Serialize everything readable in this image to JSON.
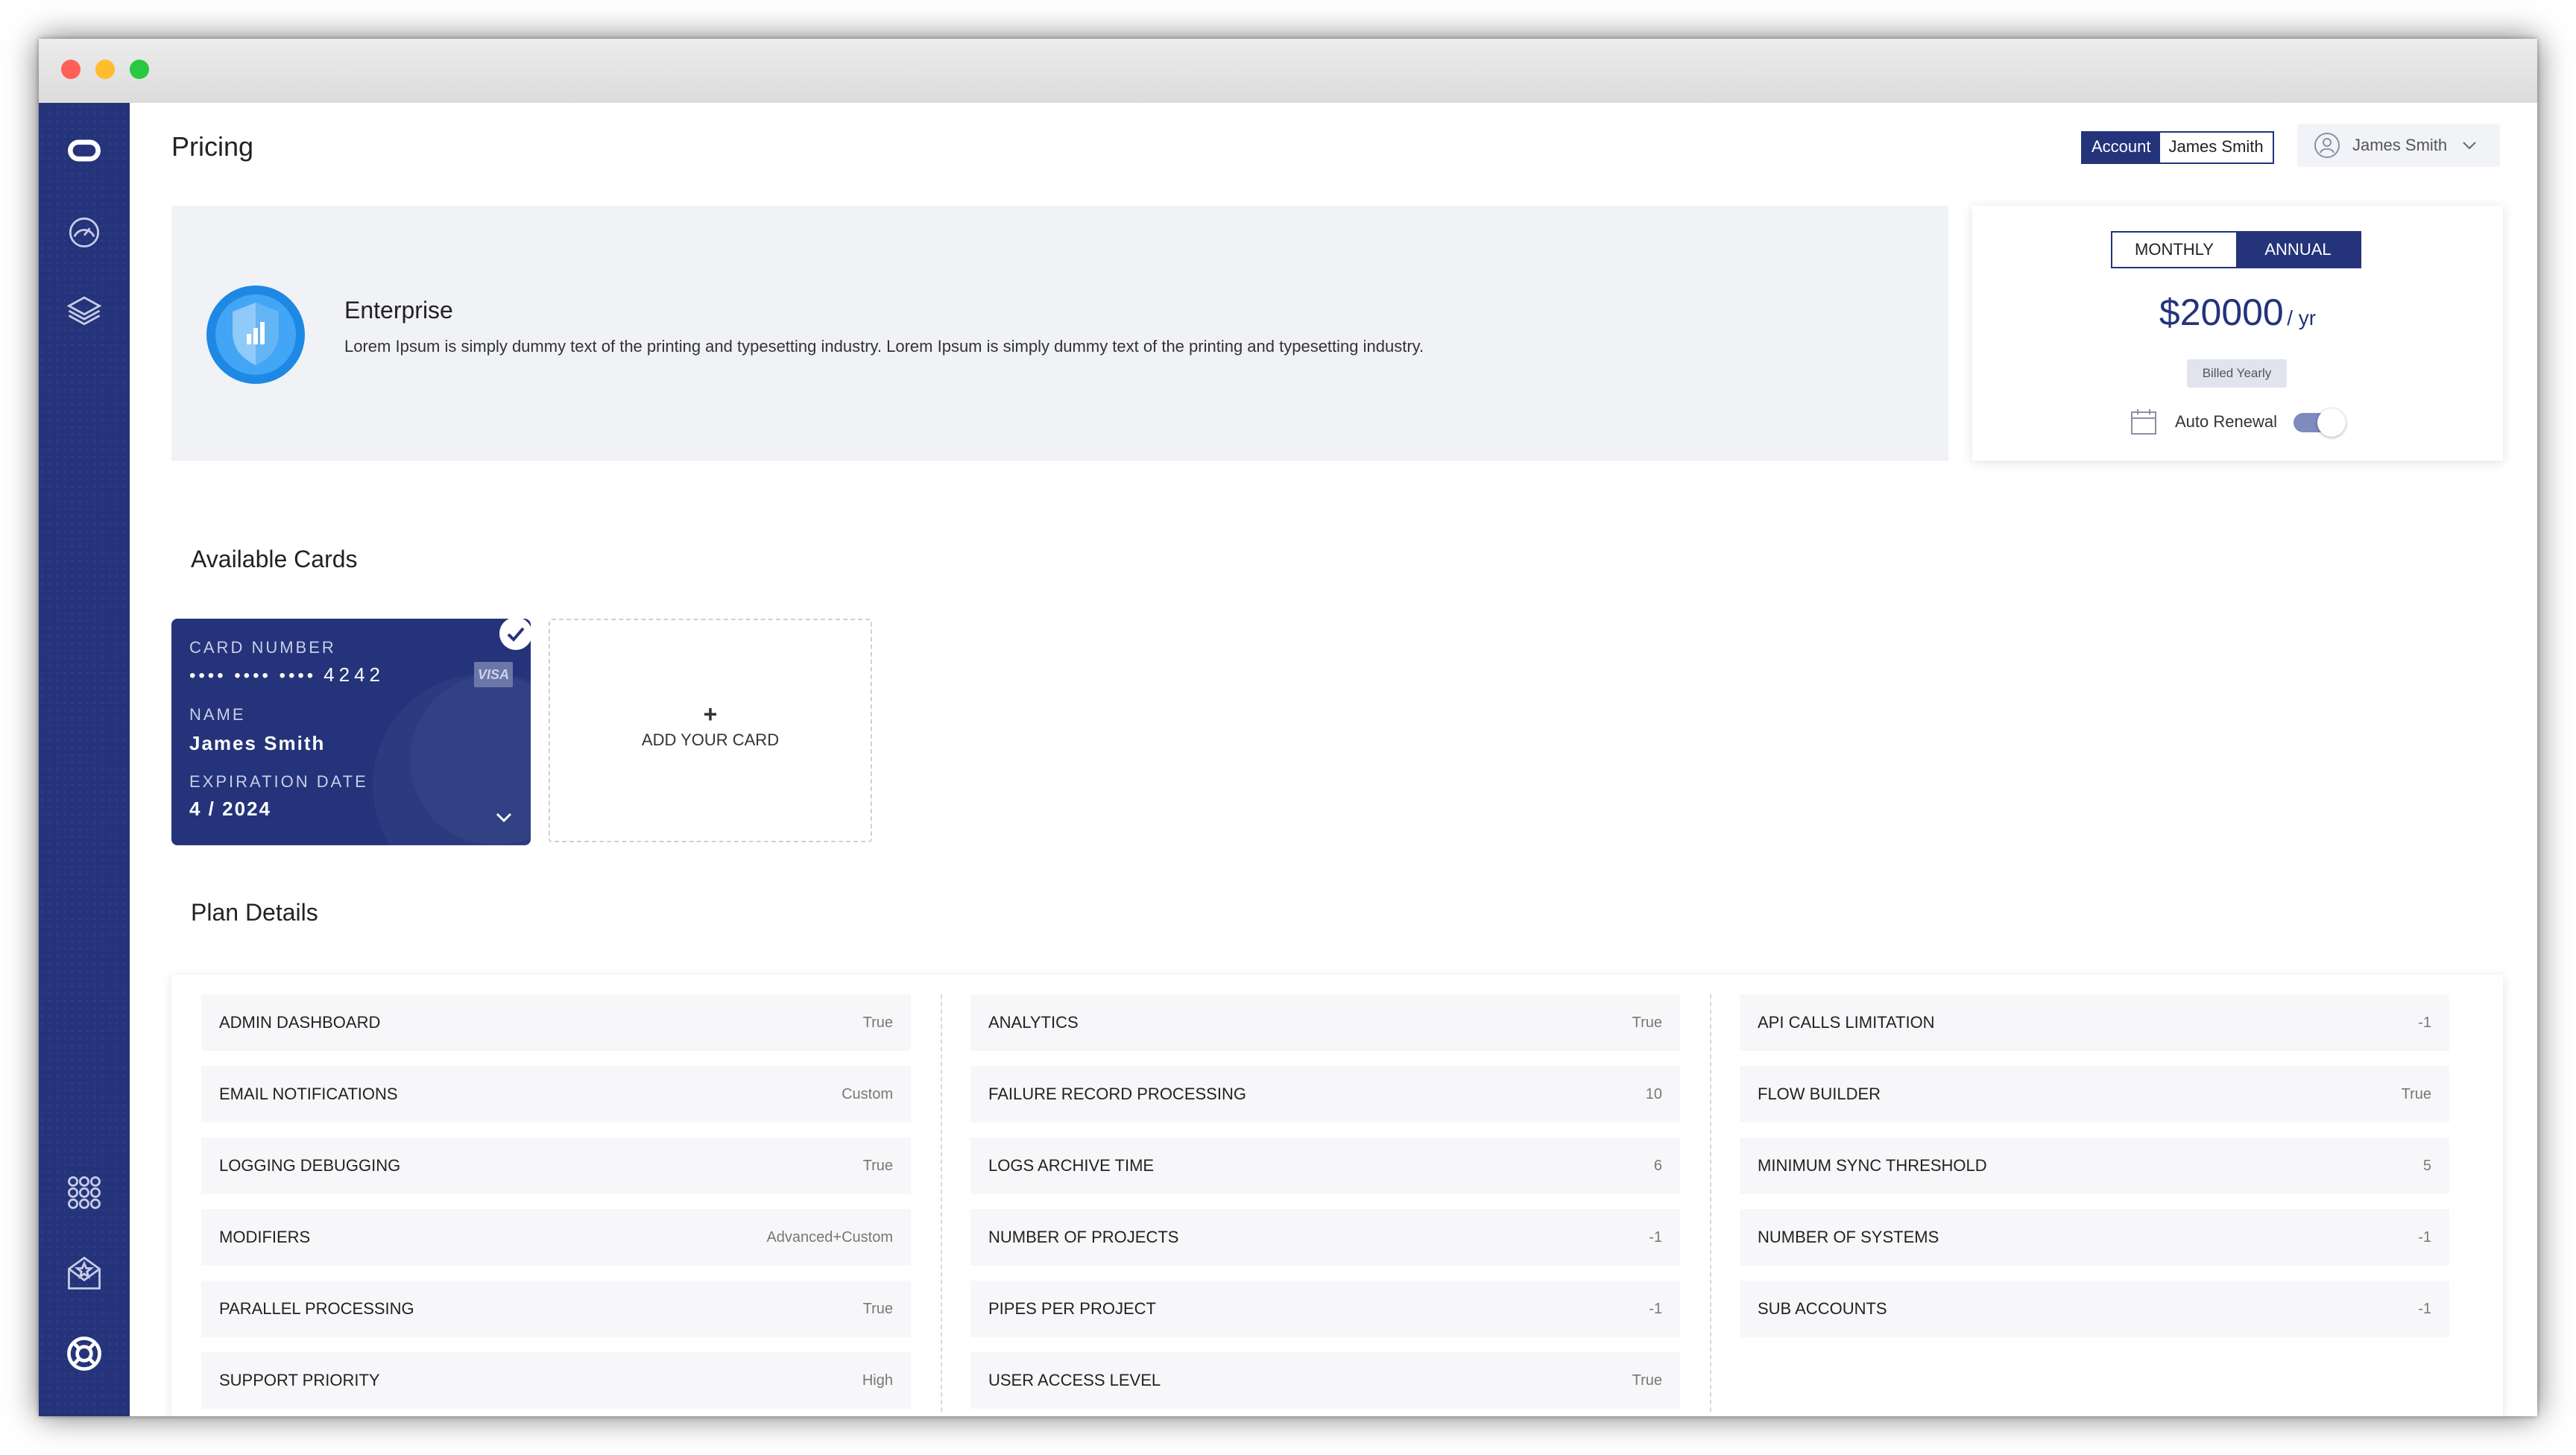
{
  "page": {
    "title": "Pricing"
  },
  "header": {
    "account_label": "Account",
    "account_name": "James Smith",
    "user_name": "James Smith"
  },
  "sidebar": {
    "icons": [
      "logo-icon",
      "speedometer-icon",
      "layers-icon",
      "apps-grid-icon",
      "mail-star-icon",
      "lifebuoy-icon"
    ]
  },
  "plan": {
    "name": "Enterprise",
    "description": "Lorem Ipsum is simply dummy text of the printing and typesetting industry. Lorem Ipsum is simply dummy text of the printing and typesetting industry."
  },
  "pricing": {
    "monthly_label": "MONTHLY",
    "annual_label": "ANNUAL",
    "selected_period": "ANNUAL",
    "currency": "$",
    "amount": "20000",
    "per": "/ yr",
    "billed": "Billed Yearly",
    "auto_renewal_label": "Auto Renewal",
    "auto_renewal_on": true
  },
  "cards": {
    "section_title": "Available Cards",
    "items": [
      {
        "number_label": "CARD NUMBER",
        "masked": "•••• •••• ••••",
        "last4": "4242",
        "brand": "VISA",
        "name_label": "NAME",
        "name": "James Smith",
        "expiry_label": "EXPIRATION DATE",
        "expiry": "4 / 2024",
        "selected": true
      }
    ],
    "add_label": "ADD YOUR CARD",
    "add_symbol": "+"
  },
  "plan_details": {
    "section_title": "Plan Details",
    "columns": [
      [
        {
          "name": "Admin Dashboard",
          "value": "True"
        },
        {
          "name": "Email Notifications",
          "value": "Custom"
        },
        {
          "name": "Logging Debugging",
          "value": "True"
        },
        {
          "name": "Modifiers",
          "value": "Advanced+Custom"
        },
        {
          "name": "Parallel Processing",
          "value": "True"
        },
        {
          "name": "Support Priority",
          "value": "High"
        }
      ],
      [
        {
          "name": "Analytics",
          "value": "True"
        },
        {
          "name": "Failure Record Processing",
          "value": "10"
        },
        {
          "name": "Logs Archive Time",
          "value": "6"
        },
        {
          "name": "Number of Projects",
          "value": "-1"
        },
        {
          "name": "Pipes per Project",
          "value": "-1"
        },
        {
          "name": "User Access Level",
          "value": "True"
        }
      ],
      [
        {
          "name": "API Calls Limitation",
          "value": "-1"
        },
        {
          "name": "Flow Builder",
          "value": "True"
        },
        {
          "name": "Minimum Sync Threshold",
          "value": "5"
        },
        {
          "name": "Number of Systems",
          "value": "-1"
        },
        {
          "name": "Sub Accounts",
          "value": "-1"
        }
      ]
    ]
  },
  "colors": {
    "primary": "#24337a",
    "toggle_track": "#7e8bbf",
    "panel_bg": "#f1f2f6"
  }
}
